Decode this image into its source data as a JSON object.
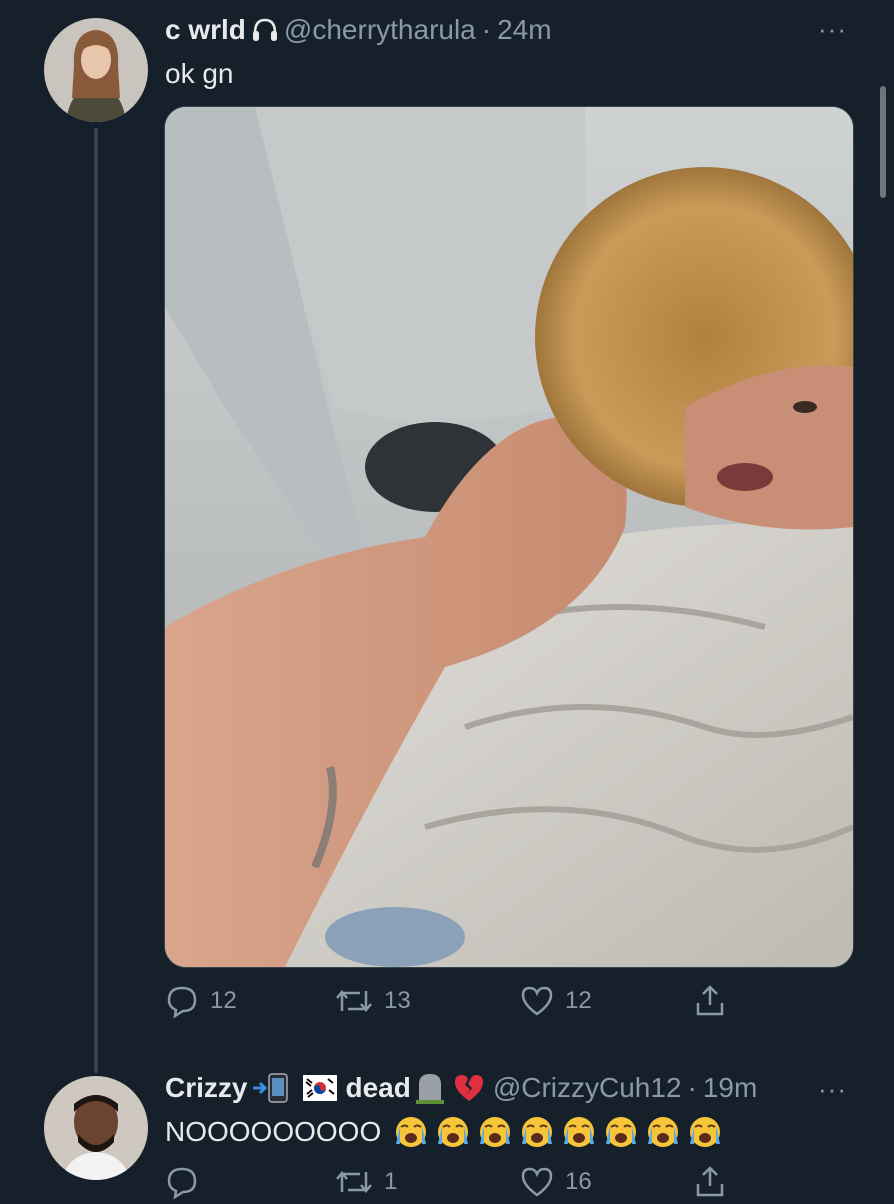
{
  "tweet1": {
    "display_name": "c wrld",
    "name_icon": "headphones-icon",
    "handle": "@cherrytharula",
    "separator": "·",
    "time": "24m",
    "text": "ok gn",
    "more": "···",
    "actions": {
      "replies": "12",
      "retweets": "13",
      "likes": "12"
    }
  },
  "tweet2": {
    "display_name": "Crizzy",
    "name_icons": [
      "arrow-phone-icon",
      "korea-flag-icon"
    ],
    "name_suffix": "dead",
    "suffix_icons": [
      "headstone-icon",
      "broken-heart-icon"
    ],
    "handle": "@CrizzyCuh12",
    "separator": "·",
    "time": "19m",
    "text": "NOOOOOOOOO",
    "emoji_count": 8,
    "emoji_name": "loudly-crying-face-icon",
    "more": "···",
    "actions": {
      "replies": "",
      "retweets": "1",
      "likes": "16"
    }
  },
  "colors": {
    "background": "#15202b",
    "text": "#e7e9ea",
    "muted": "#8b98a5",
    "thread_line": "#38444d"
  }
}
